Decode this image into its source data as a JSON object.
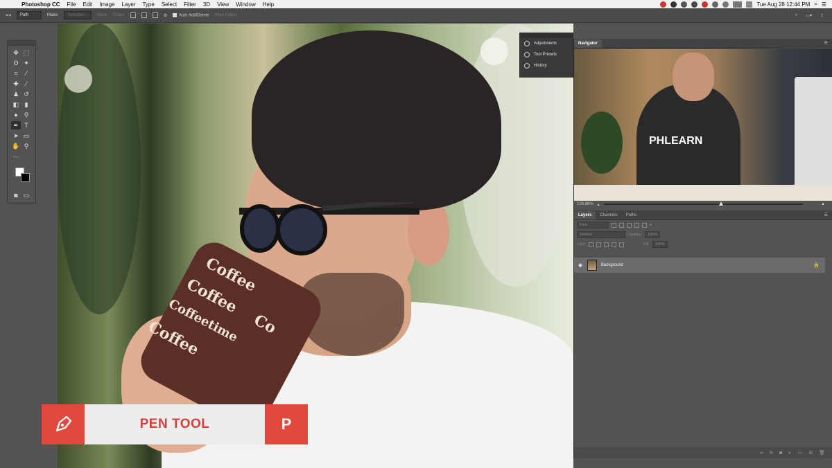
{
  "menubar": {
    "apple": "",
    "items": [
      "Photoshop CC",
      "File",
      "Edit",
      "Image",
      "Layer",
      "Type",
      "Select",
      "Filter",
      "3D",
      "View",
      "Window",
      "Help"
    ],
    "clock": "Tue Aug 28  12:44 PM"
  },
  "options": {
    "mode": "Path",
    "make_label": "Make:",
    "selection": "Selection...",
    "mask": "Mask",
    "shape": "Shape",
    "auto_add_delete": "Auto Add/Delete",
    "align_edges": "Align Edges"
  },
  "overlay": {
    "title": "PEN TOOL",
    "shortcut": "P"
  },
  "mug_text": [
    "Coffee",
    "Coffee",
    "Coffeetime",
    "Coffee",
    "Co"
  ],
  "mini_panel": {
    "items": [
      "Adjustments",
      "Tool Presets",
      "History"
    ]
  },
  "navigator": {
    "tab": "Navigator",
    "zoom": "106.88%",
    "shirt_logo": "PHLEARN"
  },
  "layers_panel": {
    "tabs": [
      "Layers",
      "Channels",
      "Paths"
    ],
    "kind": "Kind",
    "blend": "Normal",
    "opacity_label": "Opacity:",
    "opacity_val": "100%",
    "lock_label": "Lock:",
    "fill_label": "Fill:",
    "fill_val": "100%",
    "layer_name": "Background"
  }
}
